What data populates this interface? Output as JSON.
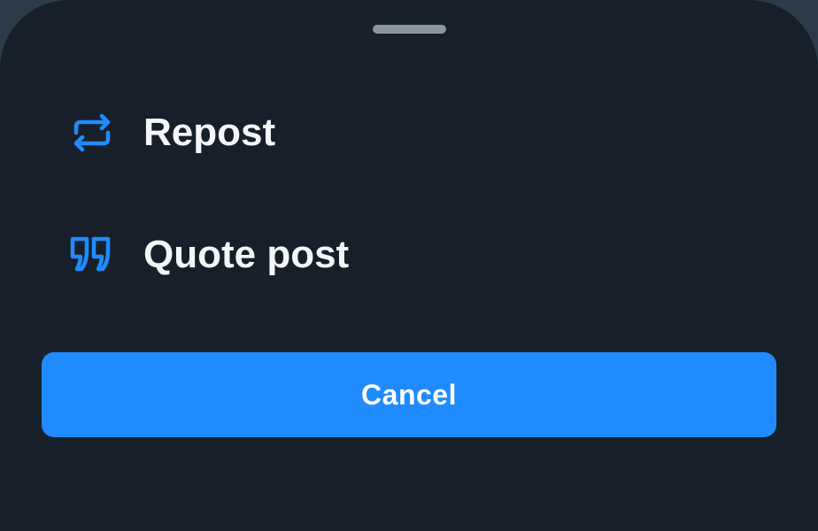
{
  "sheet": {
    "items": [
      {
        "label": "Repost",
        "icon": "repost-icon"
      },
      {
        "label": "Quote post",
        "icon": "quote-icon"
      }
    ],
    "cancel_label": "Cancel"
  },
  "colors": {
    "background": "#17202a",
    "accent": "#208bfe",
    "text": "#f4f6f8",
    "handle": "#8b95a1"
  }
}
